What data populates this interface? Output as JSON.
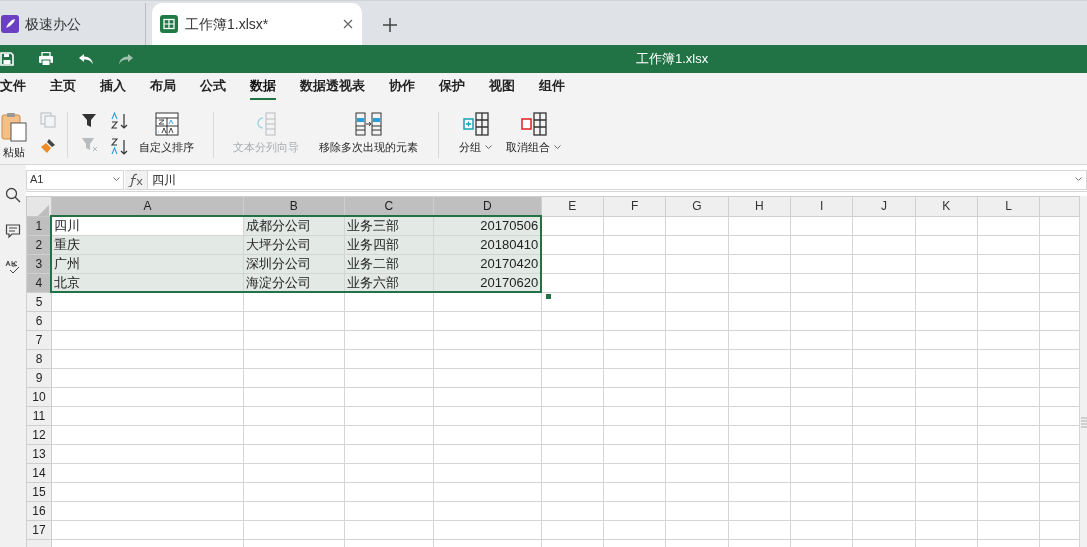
{
  "tabs": [
    {
      "label": "极速办公",
      "selected": false,
      "kind": "app"
    },
    {
      "label": "工作簿1.xlsx*",
      "selected": true,
      "kind": "document"
    }
  ],
  "title_bar": {
    "title": "工作簿1.xlsx"
  },
  "menu": [
    {
      "label": "文件",
      "selected": false
    },
    {
      "label": "主页",
      "selected": false
    },
    {
      "label": "插入",
      "selected": false
    },
    {
      "label": "布局",
      "selected": false
    },
    {
      "label": "公式",
      "selected": false
    },
    {
      "label": "数据",
      "selected": true
    },
    {
      "label": "数据透视表",
      "selected": false
    },
    {
      "label": "协作",
      "selected": false
    },
    {
      "label": "保护",
      "selected": false
    },
    {
      "label": "视图",
      "selected": false
    },
    {
      "label": "组件",
      "selected": false
    }
  ],
  "ribbon": {
    "paste": {
      "label": "粘贴"
    },
    "copy": {
      "disabled": true
    },
    "clear_filter": {
      "disabled": true
    },
    "custom_sort": {
      "label": "自定义排序"
    },
    "text_to_columns": {
      "label": "文本分列向导",
      "disabled": true
    },
    "remove_duplicates": {
      "label": "移除多次出现的元素",
      "disabled": false
    },
    "group": {
      "label": "分组"
    },
    "ungroup": {
      "label": "取消组合"
    }
  },
  "formula_bar": {
    "cell_ref": "A1",
    "formula": "四川"
  },
  "sheet": {
    "columns": [
      {
        "label": "A",
        "selected": true
      },
      {
        "label": "B",
        "selected": true
      },
      {
        "label": "C",
        "selected": true
      },
      {
        "label": "D",
        "selected": true
      },
      {
        "label": "E",
        "selected": false
      },
      {
        "label": "F",
        "selected": false
      },
      {
        "label": "G",
        "selected": false
      },
      {
        "label": "H",
        "selected": false
      },
      {
        "label": "I",
        "selected": false
      },
      {
        "label": "J",
        "selected": false
      },
      {
        "label": "K",
        "selected": false
      },
      {
        "label": "L",
        "selected": false
      }
    ],
    "rows": [
      {
        "label": "1",
        "selected": true,
        "cells": [
          {
            "text": "四川",
            "active": true,
            "kind": "text"
          },
          {
            "text": "成都分公司",
            "active": false,
            "kind": "text"
          },
          {
            "text": "业务三部",
            "active": false,
            "kind": "text"
          },
          {
            "text": "20170506",
            "active": false,
            "kind": "number"
          }
        ]
      },
      {
        "label": "2",
        "selected": true,
        "cells": [
          {
            "text": "重庆",
            "active": false,
            "kind": "text"
          },
          {
            "text": "大坪分公司",
            "active": false,
            "kind": "text"
          },
          {
            "text": "业务四部",
            "active": false,
            "kind": "text"
          },
          {
            "text": "20180410",
            "active": false,
            "kind": "number"
          }
        ]
      },
      {
        "label": "3",
        "selected": true,
        "cells": [
          {
            "text": "广州",
            "active": false,
            "kind": "text"
          },
          {
            "text": "深圳分公司",
            "active": false,
            "kind": "text"
          },
          {
            "text": "业务二部",
            "active": false,
            "kind": "text"
          },
          {
            "text": "20170420",
            "active": false,
            "kind": "number"
          }
        ]
      },
      {
        "label": "4",
        "selected": true,
        "cells": [
          {
            "text": "北京",
            "active": false,
            "kind": "text"
          },
          {
            "text": "海淀分公司",
            "active": false,
            "kind": "text"
          },
          {
            "text": "业务六部",
            "active": false,
            "kind": "text"
          },
          {
            "text": "20170620",
            "active": false,
            "kind": "number"
          }
        ]
      },
      {
        "label": "5",
        "selected": false
      },
      {
        "label": "6",
        "selected": false
      },
      {
        "label": "7",
        "selected": false
      },
      {
        "label": "8",
        "selected": false
      },
      {
        "label": "9",
        "selected": false
      },
      {
        "label": "10",
        "selected": false
      },
      {
        "label": "11",
        "selected": false
      },
      {
        "label": "12",
        "selected": false
      },
      {
        "label": "13",
        "selected": false
      },
      {
        "label": "14",
        "selected": false
      },
      {
        "label": "15",
        "selected": false
      },
      {
        "label": "16",
        "selected": false
      },
      {
        "label": "17",
        "selected": false
      }
    ]
  }
}
